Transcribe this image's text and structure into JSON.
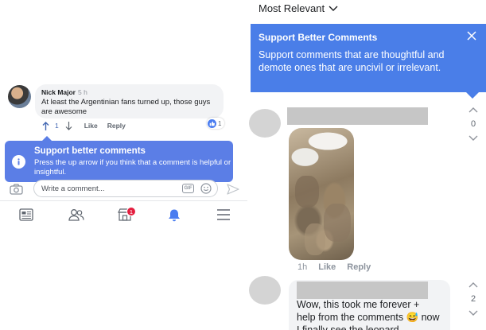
{
  "left_panel": {
    "comment": {
      "author": "Nick Major",
      "time": "5 h",
      "text": "At least the Argentinian fans turned up, those guys are awesome",
      "vote_count": "1",
      "like_label": "Like",
      "reply_label": "Reply",
      "reaction_count": "1"
    },
    "tooltip": {
      "title": "Support better comments",
      "body": "Press the up arrow if you think that a comment is helpful or insightful."
    },
    "composer": {
      "placeholder": "Write a comment...",
      "gif_label": "GIF"
    },
    "tabbar": {
      "notification_badge": "1",
      "icons": [
        "news-feed-icon",
        "friends-icon",
        "marketplace-icon",
        "notifications-bell-icon",
        "menu-icon"
      ]
    },
    "colors": {
      "tooltip_bg": "#5b7ee6",
      "badge_red": "#e41e3f",
      "link_blue": "#4267b2"
    }
  },
  "right_panel": {
    "sort_label": "Most Relevant",
    "tooltip": {
      "title": "Support Better Comments",
      "body": "Support comments that are thoughtful and demote ones that are uncivil or irrelevant."
    },
    "comment1": {
      "time": "1h",
      "like_label": "Like",
      "reply_label": "Reply",
      "vote_count": "0"
    },
    "comment2": {
      "text": "Wow, this took me forever + help from the comments 😅 now I finally see the leopard",
      "vote_count": "2"
    },
    "colors": {
      "tooltip_bg": "#4a7ee8",
      "placeholder_gray": "#c6c6c6"
    }
  }
}
